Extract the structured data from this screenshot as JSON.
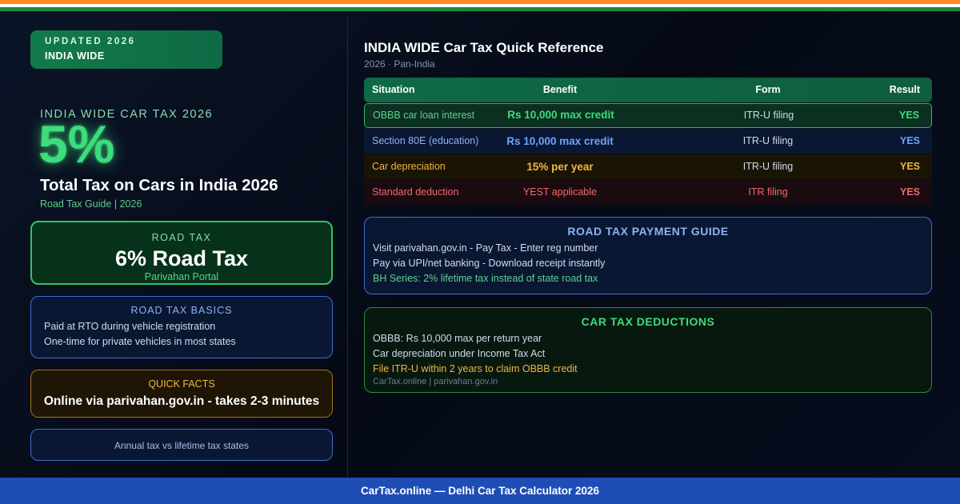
{
  "badge": {
    "line1": "UPDATED 2026",
    "line2": "INDIA WIDE"
  },
  "hero": {
    "label": "INDIA WIDE CAR TAX 2026",
    "value": "5%",
    "title": "Total Tax on Cars in India 2026",
    "subtitle": "Road Tax Guide | 2026"
  },
  "road_tax_card": {
    "label": "ROAD TAX",
    "value": "6% Road Tax",
    "sub": "Parivahan Portal"
  },
  "basics_card": {
    "heading": "ROAD TAX BASICS",
    "lines": [
      "Paid at RTO during vehicle registration",
      "One-time for private vehicles in most states"
    ]
  },
  "facts_card": {
    "heading": "QUICK FACTS",
    "text": "Online via parivahan.gov.in - takes 2-3 minutes"
  },
  "annual_card": {
    "text": "Annual tax vs lifetime tax states"
  },
  "reference": {
    "title": "INDIA WIDE Car Tax Quick Reference",
    "subtitle": "2026 · Pan-India"
  },
  "table": {
    "headers": [
      "Situation",
      "Benefit",
      "Form",
      "Result"
    ],
    "rows": [
      [
        "OBBB car loan interest",
        "Rs 10,000 max credit",
        "ITR-U filing",
        "YES"
      ],
      [
        "Section 80E (education)",
        "Rs 10,000 max credit",
        "ITR-U filing",
        "YES"
      ],
      [
        "Car depreciation",
        "15% per year",
        "ITR-U filing",
        "YES"
      ],
      [
        "Standard deduction",
        "YEST applicable",
        "ITR filing",
        "YES"
      ]
    ]
  },
  "payment_guide": {
    "heading": "ROAD TAX PAYMENT GUIDE",
    "lines": [
      "Visit parivahan.gov.in - Pay Tax - Enter reg number",
      "Pay via UPI/net banking - Download receipt instantly",
      "BH Series: 2% lifetime tax instead of state road tax"
    ]
  },
  "deductions": {
    "heading": "CAR TAX DEDUCTIONS",
    "lines": [
      "OBBB: Rs 10,000 max per return year",
      "Car depreciation under Income Tax Act",
      "File ITR-U within 2 years to claim OBBB credit"
    ],
    "source": "CarTax.online | parivahan.gov.in"
  },
  "footer": {
    "text": "CarTax.online — Delhi Car Tax Calculator 2026"
  },
  "colors": {
    "saffron": "#ff8a1f",
    "india_green": "#1c8a3a",
    "accent_green": "#3ddc7c",
    "accent_blue": "#6ea2ff",
    "accent_gold": "#f1b642",
    "accent_red": "#f06a6a",
    "footer_blue": "#1e4db5"
  }
}
